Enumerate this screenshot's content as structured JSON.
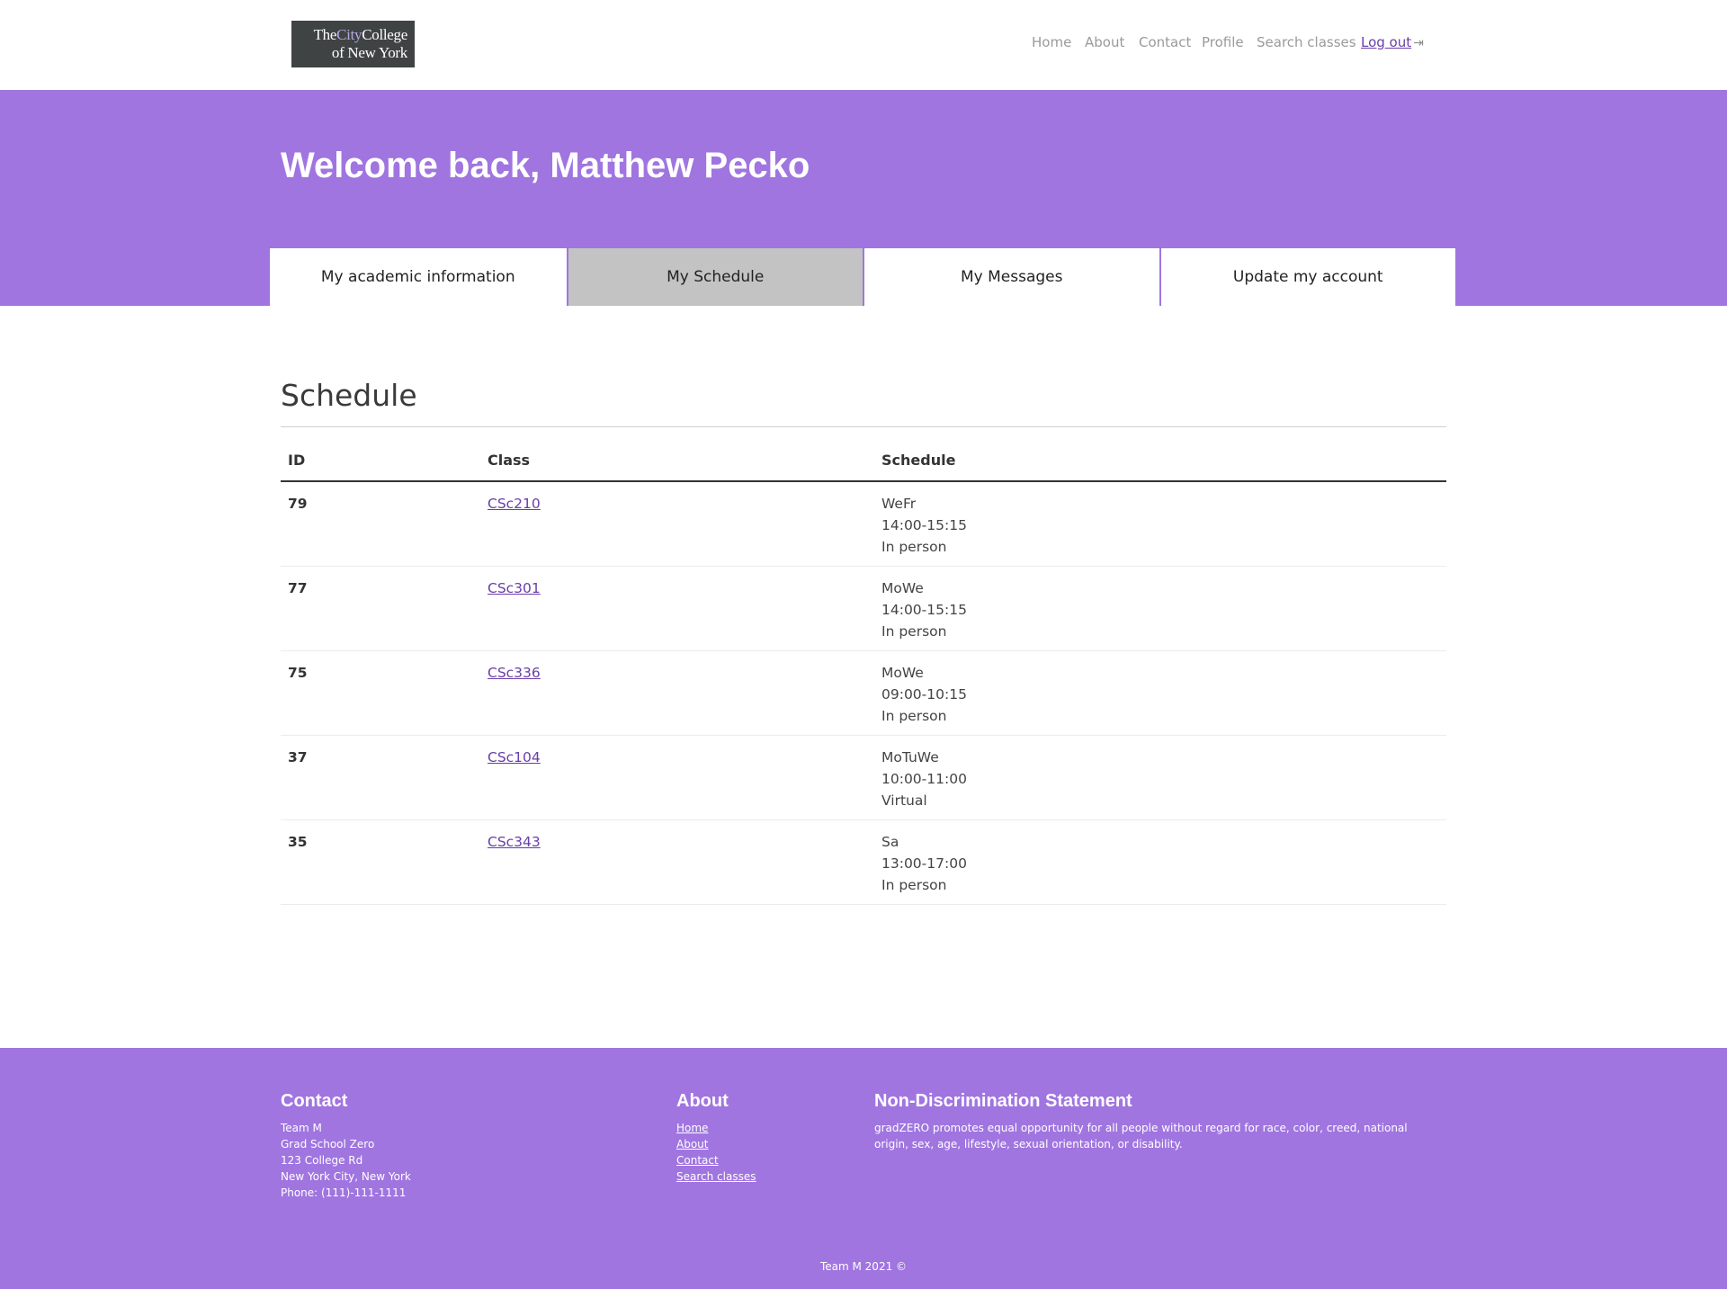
{
  "logo": {
    "line1_a": "The",
    "line1_b": "City",
    "line1_c": "College",
    "line2": "of New York"
  },
  "nav": {
    "items": [
      "Home",
      "About",
      "Contact",
      "Profile",
      "Search classes"
    ],
    "logout_label": "Log out"
  },
  "hero": {
    "welcome": "Welcome back, Matthew Pecko"
  },
  "tabs": [
    {
      "label": "My academic information",
      "active": false
    },
    {
      "label": "My Schedule",
      "active": true
    },
    {
      "label": "My Messages",
      "active": false
    },
    {
      "label": "Update my account",
      "active": false
    }
  ],
  "schedule": {
    "title": "Schedule",
    "headers": {
      "id": "ID",
      "class": "Class",
      "schedule": "Schedule"
    },
    "rows": [
      {
        "id": "79",
        "class": "CSc210",
        "days": "WeFr",
        "time": "14:00-15:15",
        "mode": "In person"
      },
      {
        "id": "77",
        "class": "CSc301",
        "days": "MoWe",
        "time": "14:00-15:15",
        "mode": "In person"
      },
      {
        "id": "75",
        "class": "CSc336",
        "days": "MoWe",
        "time": "09:00-10:15",
        "mode": "In person"
      },
      {
        "id": "37",
        "class": "CSc104",
        "days": "MoTuWe",
        "time": "10:00-11:00",
        "mode": "Virtual"
      },
      {
        "id": "35",
        "class": "CSc343",
        "days": "Sa",
        "time": "13:00-17:00",
        "mode": "In person"
      }
    ]
  },
  "footer": {
    "contact": {
      "title": "Contact",
      "lines": [
        "Team M",
        "Grad School Zero",
        "123 College Rd",
        "New York City, New York",
        "Phone: (111)-111-1111"
      ]
    },
    "about": {
      "title": "About",
      "links": [
        "Home",
        "About",
        "Contact",
        "Search classes"
      ]
    },
    "statement": {
      "title": "Non-Discrimination Statement",
      "text": "gradZERO promotes equal opportunity for all people without regard for race, color, creed, national origin, sex, age, lifestyle, sexual orientation, or disability."
    },
    "copyright": "Team M 2021 ©"
  },
  "colors": {
    "accent": "#a075e0",
    "active_tab": "#c3c3c3",
    "link": "#6a3ea8",
    "logo_bg": "#3f4344"
  }
}
